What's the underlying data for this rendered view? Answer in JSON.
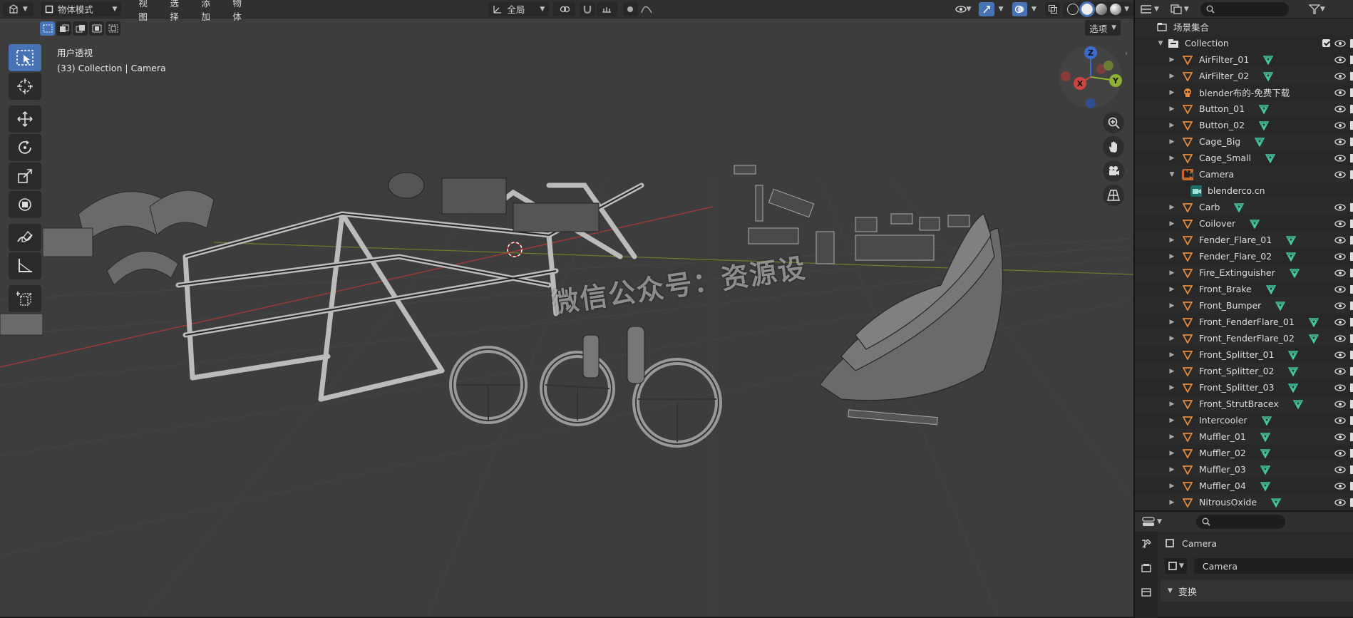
{
  "viewport": {
    "header": {
      "editor_type_icon": "view3d-icon",
      "mode": "物体模式",
      "menus": [
        "视图",
        "选择",
        "添加",
        "物体"
      ],
      "orientation": "全局",
      "options_label": "选项"
    },
    "info": {
      "view_name": "用户透视",
      "object_info": "(33) Collection | Camera"
    },
    "watermark": "微信公众号：资源设",
    "gizmo_axes": {
      "x": "X",
      "y": "Y",
      "z": "Z"
    },
    "tools": [
      "select-box-icon",
      "cursor-icon",
      "move-icon",
      "rotate-icon",
      "scale-icon",
      "transform-icon",
      "annotate-icon",
      "measure-icon",
      "add-cube-icon"
    ]
  },
  "outliner": {
    "scene_collection": "场景集合",
    "collection": "Collection",
    "items": [
      {
        "name": "AirFilter_01",
        "type": "mesh"
      },
      {
        "name": "AirFilter_02",
        "type": "mesh"
      },
      {
        "name": "blender布的-免费下载",
        "type": "skull"
      },
      {
        "name": "Button_01",
        "type": "mesh"
      },
      {
        "name": "Button_02",
        "type": "mesh"
      },
      {
        "name": "Cage_Big",
        "type": "mesh"
      },
      {
        "name": "Cage_Small",
        "type": "mesh"
      },
      {
        "name": "Camera",
        "type": "camera",
        "expanded": true
      },
      {
        "name": "blenderco.cn",
        "type": "camera-data",
        "child": true
      },
      {
        "name": "Carb",
        "type": "mesh"
      },
      {
        "name": "Coilover",
        "type": "mesh"
      },
      {
        "name": "Fender_Flare_01",
        "type": "mesh"
      },
      {
        "name": "Fender_Flare_02",
        "type": "mesh"
      },
      {
        "name": "Fire_Extinguisher",
        "type": "mesh"
      },
      {
        "name": "Front_Brake",
        "type": "mesh"
      },
      {
        "name": "Front_Bumper",
        "type": "mesh"
      },
      {
        "name": "Front_FenderFlare_01",
        "type": "mesh"
      },
      {
        "name": "Front_FenderFlare_02",
        "type": "mesh"
      },
      {
        "name": "Front_Splitter_01",
        "type": "mesh"
      },
      {
        "name": "Front_Splitter_02",
        "type": "mesh"
      },
      {
        "name": "Front_Splitter_03",
        "type": "mesh"
      },
      {
        "name": "Front_StrutBracex",
        "type": "mesh"
      },
      {
        "name": "Intercooler",
        "type": "mesh"
      },
      {
        "name": "Muffler_01",
        "type": "mesh"
      },
      {
        "name": "Muffler_02",
        "type": "mesh"
      },
      {
        "name": "Muffler_03",
        "type": "mesh"
      },
      {
        "name": "Muffler_04",
        "type": "mesh"
      },
      {
        "name": "NitrousOxide",
        "type": "mesh"
      }
    ]
  },
  "properties": {
    "object_name_display": "Camera",
    "object_name_field": "Camera",
    "panel_transform": "变换"
  },
  "colors": {
    "accent": "#4772b3",
    "mesh_orange": "#e8893a",
    "data_green": "#44c8a0",
    "viewport_bg": "#3d3d3d"
  }
}
